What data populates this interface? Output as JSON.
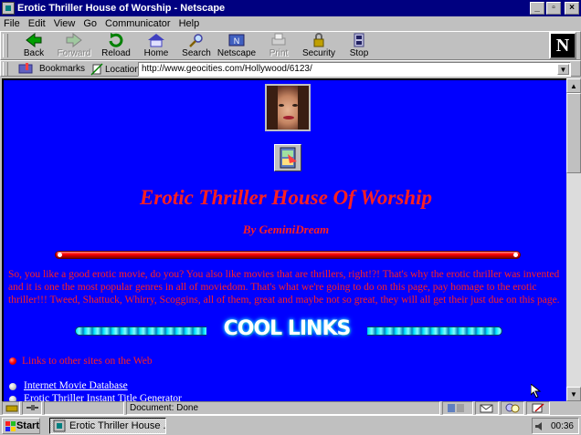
{
  "window": {
    "title": "Erotic Thriller House of Worship - Netscape"
  },
  "menu": [
    "File",
    "Edit",
    "View",
    "Go",
    "Communicator",
    "Help"
  ],
  "toolbar": {
    "buttons": [
      {
        "label": "Back",
        "icon": "back-arrow-icon",
        "enabled": true
      },
      {
        "label": "Forward",
        "icon": "forward-arrow-icon",
        "enabled": false
      },
      {
        "label": "Reload",
        "icon": "reload-icon",
        "enabled": true
      },
      {
        "label": "Home",
        "icon": "home-icon",
        "enabled": true
      },
      {
        "label": "Search",
        "icon": "search-icon",
        "enabled": true
      },
      {
        "label": "Netscape",
        "icon": "netscape-icon",
        "enabled": true
      },
      {
        "label": "Print",
        "icon": "print-icon",
        "enabled": false
      },
      {
        "label": "Security",
        "icon": "security-lock-icon",
        "enabled": true
      },
      {
        "label": "Stop",
        "icon": "stop-icon",
        "enabled": true
      }
    ],
    "logo": "N"
  },
  "location": {
    "bookmarks_label": "Bookmarks",
    "location_label": "Location:",
    "url": "http://www.geocities.com/Hollywood/6123/"
  },
  "page": {
    "title": "Erotic Thriller House Of Worship",
    "byline": "By GeminiDream",
    "intro": "So, you like a good erotic movie, do you? You also like movies that are thrillers, right!?! That's why the erotic thriller was invented and it is one the most popular genres in all of moviedom. That's what we're going to do on this page, pay homage to the erotic thriller!!! Tweed, Shattuck, Whirry, Scoggins, all of them, great and maybe not so great, they will all get their just due on this page.",
    "cool_links": "COOL LINKS",
    "links_heading": "Links to other sites on the Web",
    "links": [
      "Internet Movie Database",
      "Erotic Thriller Instant Title Generator"
    ]
  },
  "status": {
    "text": "Document: Done"
  },
  "taskbar": {
    "start": "Start",
    "task": "Erotic Thriller House ...",
    "clock": "00:36"
  },
  "colors": {
    "page_background": "#0000ff",
    "page_text": "#ff2020",
    "title_bar": "#000080",
    "chrome": "#c0c0c0"
  }
}
